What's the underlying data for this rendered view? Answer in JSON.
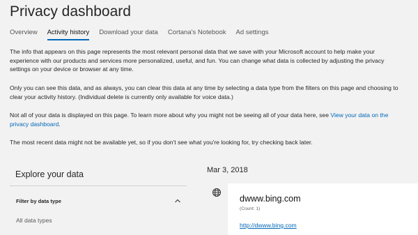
{
  "page": {
    "title": "Privacy dashboard"
  },
  "tabs": [
    {
      "label": "Overview",
      "active": false
    },
    {
      "label": "Activity history",
      "active": true
    },
    {
      "label": "Download your data",
      "active": false
    },
    {
      "label": "Cortana's Notebook",
      "active": false
    },
    {
      "label": "Ad settings",
      "active": false
    }
  ],
  "intro": {
    "p1": "The info that appears on this page represents the most relevant personal data that we save with your Microsoft account to help make your experience with our products and services more personalized, useful, and fun. You can change what data is collected by adjusting the privacy settings on your device or browser at any time.",
    "p2": "Only you can see this data, and as always, you can clear this data at any time by selecting a data type from the filters on this page and choosing to clear your activity history. (Individual delete is currently only available for voice data.)",
    "p3_text": "Not all of your data is displayed on this page. To learn more about why you might not be seeing all of your data here, see ",
    "p3_link": "View your data on the privacy dashboard",
    "p3_end": ".",
    "p4": "The most recent data might not be available yet, so if you don't see what you're looking for, try checking back later."
  },
  "explore": {
    "title": "Explore your data",
    "filter_label": "Filter by data type",
    "selected_type": "All data types"
  },
  "activity": {
    "date": "Mar 3, 2018",
    "icon": "globe-icon",
    "item_title": "dwww.bing.com",
    "item_count": "(Count: 1)",
    "item_link": "http://dwww.bing.com"
  },
  "colors": {
    "background": "#f2f2f2",
    "accent": "#0067b8",
    "card": "#ffffff"
  }
}
